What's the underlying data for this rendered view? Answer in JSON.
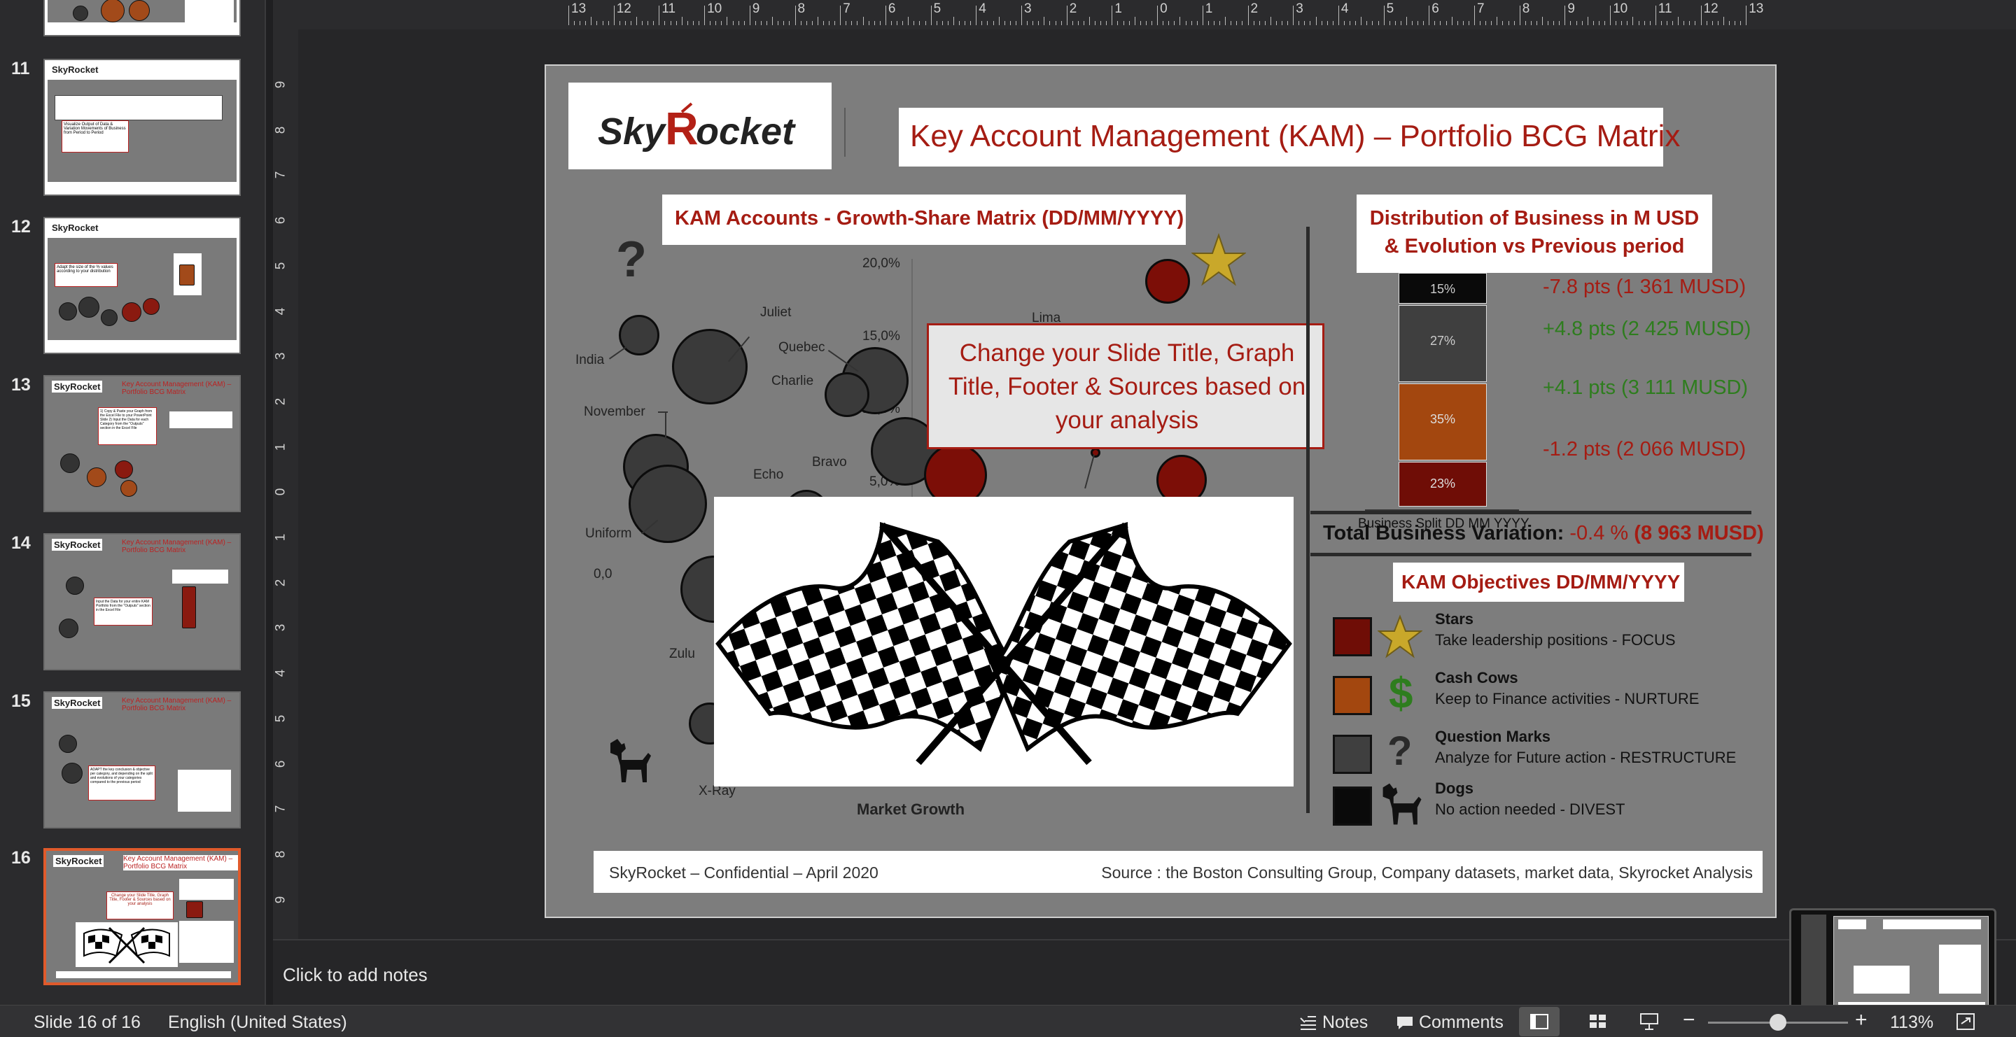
{
  "thumbnails": [
    {
      "num": "11",
      "note": "Visualize Output of Data & Variation Movements of Business from Period to Period"
    },
    {
      "num": "12",
      "note": "Adapt the size of the % values according to your distribution"
    },
    {
      "num": "13",
      "note": "1) Copy & Paste your Graph from the Excel File to your PowerPoint Slide 2) Input the Data for each Category from the \"Outputs\" section in the Excel File"
    },
    {
      "num": "14",
      "note": "Input the Data for your entire KAM Portfolio from the \"Outputs\" section in the Excel File"
    },
    {
      "num": "15",
      "note": "ADAPT the key conclusion & objective per category, and depending on the split and evolutions of your categories compared to the previous period"
    },
    {
      "num": "16",
      "note": "Change your Slide Title, Graph Title, Footer & Sources based on your analysis"
    }
  ],
  "ruler_top": [
    "13",
    "12",
    "11",
    "10",
    "9",
    "8",
    "7",
    "6",
    "5",
    "4",
    "3",
    "2",
    "1",
    "0",
    "1",
    "2",
    "3",
    "4",
    "5",
    "6",
    "7",
    "8",
    "9",
    "10",
    "11",
    "12",
    "13"
  ],
  "ruler_left": [
    "9",
    "8",
    "7",
    "6",
    "5",
    "4",
    "3",
    "2",
    "1",
    "0",
    "1",
    "2",
    "3",
    "4",
    "5",
    "6",
    "7",
    "8",
    "9"
  ],
  "slide": {
    "logo": "SkyRocket",
    "title": "Key Account Management (KAM) – Portfolio BCG Matrix",
    "chart_title": "KAM Accounts - Growth-Share Matrix (DD/MM/YYYY)",
    "y_ticks": [
      "20,0%",
      "15,0%",
      "10,0%",
      "5,0%",
      "0,0"
    ],
    "bubbles": [
      "India",
      "Juliet",
      "Quebec",
      "Charlie",
      "November",
      "Bravo",
      "Echo",
      "Uniform",
      "Lima",
      "Zulu",
      "X-Ray"
    ],
    "question_mark": "?",
    "x_axis_label": "Market Growth",
    "overlay_note": "Change your Slide Title, Graph Title, Footer & Sources based on your analysis",
    "dist_title": "Distribution of Business in M USD & Evolution vs Previous period",
    "dist_segments": [
      {
        "pct": "15%",
        "delta": "-7.8 pts (1 361 MUSD)",
        "color": "#0a0a0a",
        "tone": "red"
      },
      {
        "pct": "27%",
        "delta": "+4.8 pts (2 425 MUSD)",
        "color": "#3f3f3f",
        "tone": "green"
      },
      {
        "pct": "35%",
        "delta": "+4.1 pts (3 111 MUSD)",
        "color": "#a3470f",
        "tone": "green"
      },
      {
        "pct": "23%",
        "delta": "-1.2 pts (2 066 MUSD)",
        "color": "#6f0d06",
        "tone": "red"
      }
    ],
    "dist_axis_label": "Business Split DD MM YYYY",
    "total_label": "Total Business Variation:",
    "total_pct": "-0.4 %",
    "total_musd": "(8 963 MUSD)",
    "objectives_title": "KAM Objectives DD/MM/YYYY",
    "objectives": [
      {
        "name": "Stars",
        "desc": "Take leadership positions - FOCUS",
        "color": "#6f0d06",
        "icon": "star-icon"
      },
      {
        "name": "Cash Cows",
        "desc": "Keep to Finance activities - NURTURE",
        "color": "#a3470f",
        "icon": "dollar-icon"
      },
      {
        "name": "Question Marks",
        "desc": "Analyze for Future action - RESTRUCTURE",
        "color": "#3f3f3f",
        "icon": "question-icon"
      },
      {
        "name": "Dogs",
        "desc": "No action needed - DIVEST",
        "color": "#0a0a0a",
        "icon": "dog-icon"
      }
    ],
    "footer_left": "SkyRocket – Confidential – April 2020",
    "footer_right": "Source : the Boston Consulting Group, Company datasets, market data, Skyrocket Analysis"
  },
  "notes_placeholder": "Click to add notes",
  "status": {
    "slide_counter": "Slide 16 of 16",
    "language": "English (United States)",
    "notes_label": "Notes",
    "comments_label": "Comments",
    "zoom_minus": "−",
    "zoom_plus": "+",
    "zoom_level": "113%"
  },
  "colors": {
    "accent": "#e05a2b",
    "brand_red": "#a51c13",
    "positive": "#2e7d1e"
  }
}
